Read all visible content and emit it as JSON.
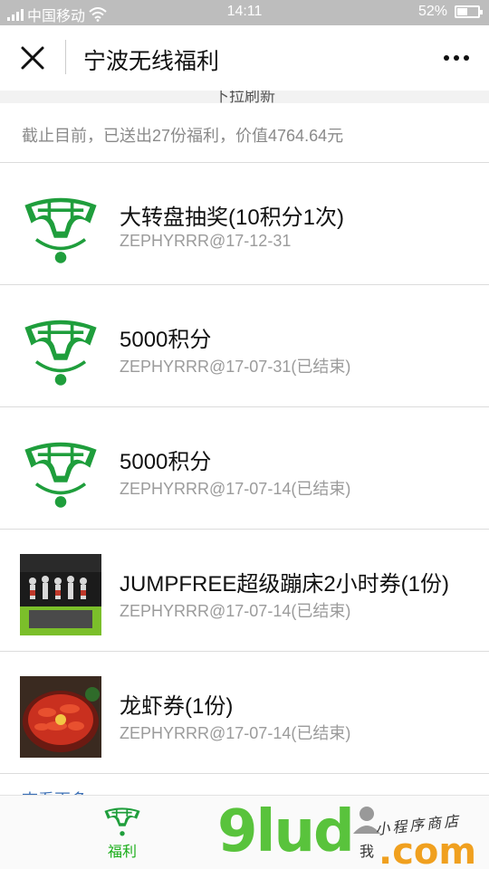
{
  "status_bar": {
    "carrier": "中国移动",
    "time": "14:11",
    "battery": "52%",
    "battery_level": 0.52
  },
  "nav": {
    "title": "宁波无线福利",
    "close_icon": "close-icon",
    "more_icon": "more-icon"
  },
  "pull_hint": "下拉刷新",
  "summary": "截止目前，已送出27份福利，价值4764.64元",
  "items": [
    {
      "title": "大转盘抽奖(10积分1次)",
      "meta": "ZEPHYRRR@17-12-31",
      "thumb": "tea-logo"
    },
    {
      "title": "5000积分",
      "meta": "ZEPHYRRR@17-07-31(已结束)",
      "thumb": "tea-logo"
    },
    {
      "title": "5000积分",
      "meta": "ZEPHYRRR@17-07-14(已结束)",
      "thumb": "tea-logo"
    },
    {
      "title": "JUMPFREE超级蹦床2小时券(1份)",
      "meta": "ZEPHYRRR@17-07-14(已结束)",
      "thumb": "trampoline-photo"
    },
    {
      "title": "龙虾券(1份)",
      "meta": "ZEPHYRRR@17-07-14(已结束)",
      "thumb": "crayfish-photo"
    }
  ],
  "view_more": "查看更多",
  "tabs": {
    "welfare": {
      "label": "福利",
      "active": true
    },
    "me": {
      "label": "我",
      "active": false
    }
  },
  "watermark": {
    "brand": "9lud",
    "com": ".com",
    "tagline": "小程序商店"
  },
  "colors": {
    "accent_green": "#1aad19",
    "logo_green": "#1f9e3c",
    "meta_gray": "#9b9b9b",
    "link_blue": "#3b6fb5"
  }
}
